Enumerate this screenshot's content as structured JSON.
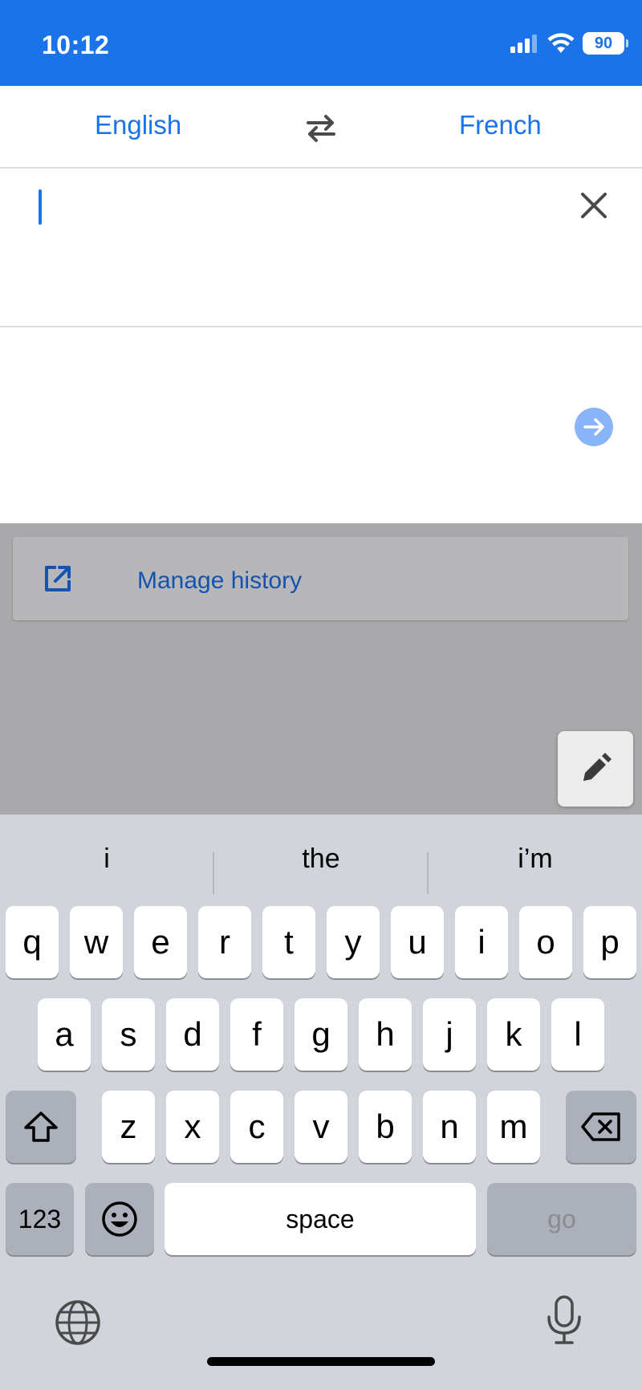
{
  "status_bar": {
    "time": "10:12",
    "battery": "90",
    "icons": [
      "signal-icon",
      "wifi-icon",
      "battery-icon"
    ]
  },
  "language_bar": {
    "source": "English",
    "target": "French",
    "swap_icon": "swap-icon"
  },
  "input": {
    "value": "",
    "clear_icon": "close-icon"
  },
  "output": {
    "translate_icon": "arrow-right-icon"
  },
  "history": {
    "label": "Manage history",
    "icon": "open-external-icon"
  },
  "handwriting": {
    "icon": "pen-icon"
  },
  "keyboard": {
    "suggestions": [
      "i",
      "the",
      "i’m"
    ],
    "row1": [
      "q",
      "w",
      "e",
      "r",
      "t",
      "y",
      "u",
      "i",
      "o",
      "p"
    ],
    "row2": [
      "a",
      "s",
      "d",
      "f",
      "g",
      "h",
      "j",
      "k",
      "l"
    ],
    "row3": [
      "z",
      "x",
      "c",
      "v",
      "b",
      "n",
      "m"
    ],
    "numbers_label": "123",
    "space_label": "space",
    "go_label": "go",
    "icons": [
      "shift-icon",
      "backspace-icon",
      "emoji-icon",
      "globe-icon",
      "microphone-icon"
    ]
  },
  "colors": {
    "accent": "#1a73e8",
    "accent_light": "#8ab4f8",
    "keyboard_bg": "#d1d4db",
    "dim_overlay": "#a9a9ab"
  }
}
